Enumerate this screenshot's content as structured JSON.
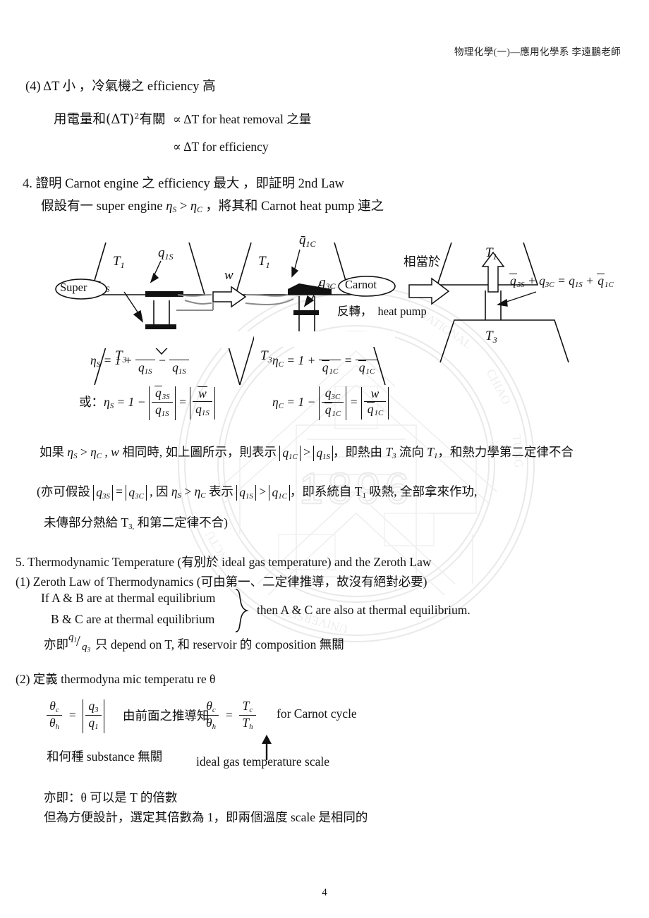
{
  "header": {
    "course": "物理化學(一)—應用化學系 李遠鵬老師"
  },
  "page_number": "4",
  "item4_prev": {
    "line1": "(4)  ΔT 小  ，冷氣機之 efficiency 高",
    "line2_left": "用電量和",
    "line2_paren": "(ΔT)",
    "line2_sup": "2",
    "line2_tail": "有關",
    "prop1": "∝  ΔT for heat removal 之量",
    "prop2": "∝  ΔT for efficiency"
  },
  "section4": {
    "line1": "4. 證明 Carnot  engine 之 efficiency 最大 ，即証明 2nd Law",
    "line2_a": "假設有一 super engine ",
    "line2_eta_s": "η",
    "line2_sub_s": "S",
    "line2_gt": " > ",
    "line2_eta_c": "η",
    "line2_sub_c": "C",
    "line2_b": " ，將其和 Carnot heat pump 連之"
  },
  "diagram": {
    "super_label": "Super",
    "carnot_label": "Carnot",
    "reversed_label": "反轉，",
    "heat_pump_label": "heat pump",
    "equivalent_label": "相當於",
    "T1": "T",
    "T1_sub": "1",
    "T3": "T",
    "T3_sub": "3",
    "q1S": "q",
    "q1S_sub": "1S",
    "q3S_bar": "q",
    "q3S_sub": "3S",
    "q1C_bar": "q",
    "q1C_sub": "1C",
    "q3C": "q",
    "q3C_sub": "3C",
    "w": "w",
    "balance_eq": "q̄3S + q3C = q1S + q̄1C"
  },
  "efficiency_block": {
    "eta_s_partial": "ηS = 1 +",
    "eta_c_partial": "ηC = 1 +",
    "eta_s_line": "或：ηS = 1 − |q̄3S / q1S| = |w̄ / q1S|",
    "eta_c_line": "ηC = 1 − |q3C / q̄1C| = |w / q̄1C|",
    "q1S_den": "q1S",
    "q1C_den": "q1C"
  },
  "paragraphs": {
    "p1": "如果 ηS > ηC , w 相同時, 如上圖所示，則表示 |q1C| > |q1S|，即熱由 T3 流向 T1，和熱力學第二定律不合",
    "p2": "(亦可假設 |q3S| = |q3C| , 因 ηS > ηC 表示 |q1S| > |q1C|，即系統自 T1 吸熱, 全部拿來作功,",
    "p3": "未傳部分熱給 T3, 和第二定律不合)"
  },
  "section5": {
    "title": "5. Thermodynamic Temperature (有別於 ideal gas temperature) and the Zeroth Law",
    "item1": "(1) Zeroth Law of Thermodynamics    (可由第一、二定律推導，故沒有絕對必要)",
    "cond1": "If  A & B are at thermal equilibrium",
    "cond2": "B & C are at thermal equilibrium",
    "conclusion": "then A & C are also at thermal equilibrium.",
    "ratio_prefix": "亦即",
    "ratio_num": "q",
    "ratio_num_sub": "1",
    "ratio_den": "q",
    "ratio_den_sub": "3",
    "ratio_tail": "只 depend on T, 和 reservoir 的 composition 無關",
    "item2": "(2)  定義 thermodyna mic temperatu re θ",
    "theta_eq_left": "θc/θh = |q3/q1|",
    "derive_text": "由前面之推導知",
    "theta_eq_right": "θc/θh = Tc/Th",
    "for_carnot": "for Carnot cycle",
    "substance_note": "和何種 substance 無關",
    "scale_note": "ideal gas temperature scale",
    "final1": "亦即：θ 可以是 T 的倍數",
    "final2": "但為方便設計，選定其倍數為 1，即兩個溫度 scale 是相同的"
  }
}
